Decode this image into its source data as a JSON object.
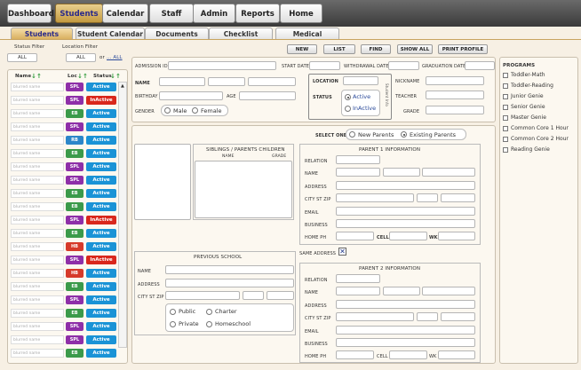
{
  "nav": {
    "tabs": [
      "Dashboard",
      "Students",
      "Calendar",
      "Staff",
      "Admin",
      "Reports",
      "Home"
    ],
    "active": "Students"
  },
  "subnav": {
    "tabs": [
      "Students",
      "Student Calendar",
      "Documents",
      "Checklist",
      "Medical"
    ]
  },
  "filters": {
    "status_label": "Status Filter",
    "location_label": "Location Filter",
    "status_value": "ALL",
    "location_value": "ALL",
    "or_text": "or",
    "all_link": "... ALL"
  },
  "list": {
    "headers": {
      "name": "Name",
      "loc": "Loc",
      "status": "Status"
    },
    "rows": [
      {
        "name": "blurred name",
        "loc": "SPL",
        "status": "Active"
      },
      {
        "name": "blurred name",
        "loc": "SPL",
        "status": "InActive"
      },
      {
        "name": "blurred name",
        "loc": "EB",
        "status": "Active"
      },
      {
        "name": "blurred name",
        "loc": "SPL",
        "status": "Active"
      },
      {
        "name": "blurred name",
        "loc": "RB",
        "status": "Active"
      },
      {
        "name": "blurred name",
        "loc": "EB",
        "status": "Active"
      },
      {
        "name": "blurred name",
        "loc": "SPL",
        "status": "Active"
      },
      {
        "name": "blurred name",
        "loc": "SPL",
        "status": "Active"
      },
      {
        "name": "blurred name",
        "loc": "EB",
        "status": "Active"
      },
      {
        "name": "blurred name",
        "loc": "EB",
        "status": "Active"
      },
      {
        "name": "blurred name",
        "loc": "SPL",
        "status": "InActive"
      },
      {
        "name": "blurred name",
        "loc": "EB",
        "status": "Active"
      },
      {
        "name": "blurred name",
        "loc": "HB",
        "status": "Active"
      },
      {
        "name": "blurred name",
        "loc": "SPL",
        "status": "InActive"
      },
      {
        "name": "blurred name",
        "loc": "HB",
        "status": "Active"
      },
      {
        "name": "blurred name",
        "loc": "EB",
        "status": "Active"
      },
      {
        "name": "blurred name",
        "loc": "SPL",
        "status": "Active"
      },
      {
        "name": "blurred name",
        "loc": "EB",
        "status": "Active"
      },
      {
        "name": "blurred name",
        "loc": "SPL",
        "status": "Active"
      },
      {
        "name": "blurred name",
        "loc": "SPL",
        "status": "Active"
      },
      {
        "name": "blurred name",
        "loc": "EB",
        "status": "Active"
      }
    ],
    "scroll_up": "▲",
    "scroll_down": "▼"
  },
  "actions": [
    "NEW",
    "LIST",
    "FIND",
    "SHOW ALL",
    "PRINT PROFILE"
  ],
  "student": {
    "admission_id": "ADMISSION ID",
    "start_date": "START DATE",
    "withdrawal_date": "WITHDRAWAL DATE",
    "graduation_date": "GRADUATION DATE",
    "name": "NAME",
    "birthday": "BIRTHDAY",
    "age": "AGE",
    "gender": "GENDER",
    "male": "Male",
    "female": "Female",
    "location": "LOCATION",
    "status": "STATUS",
    "active": "Active",
    "inactive": "InActive",
    "vertical_tag": "Student Info",
    "nickname": "NICKNAME",
    "teacher": "TEACHER",
    "grade": "GRADE"
  },
  "programs": {
    "title": "PROGRAMS",
    "items": [
      "Toddler-Math",
      "Toddler-Reading",
      "Junior Genie",
      "Senior Genie",
      "Master Genie",
      "Common Core 1 Hour",
      "Common Core 2 Hour",
      "Reading Genie"
    ]
  },
  "siblings": {
    "title": "SIBLINGS / PARENTS CHILDREN",
    "col_name": "NAME",
    "col_grade": "GRADE"
  },
  "select_one": {
    "label": "SELECT ONE",
    "new_parents": "New Parents",
    "existing_parents": "Existing Parents"
  },
  "parent1": {
    "title": "PARENT 1 INFORMATION",
    "relation": "RELATION",
    "name": "NAME",
    "address": "ADDRESS",
    "city": "CITY ST ZIP",
    "email": "EMAIL",
    "business": "BUSINESS",
    "home_ph": "HOME PH",
    "cell": "CELL",
    "wk": "WK"
  },
  "previous_school": {
    "title": "PREVIOUS SCHOOL",
    "name": "NAME",
    "address": "ADDRESS",
    "city": "CITY ST ZIP",
    "public": "Public",
    "charter": "Charter",
    "private": "Private",
    "homeschool": "Homeschool"
  },
  "same_address": {
    "label": "SAME ADDRESS",
    "mark": "✕"
  },
  "parent2": {
    "title": "PARENT 2 INFORMATION",
    "relation": "RELATION",
    "name": "NAME",
    "address": "ADDRESS",
    "city": "CITY ST ZIP",
    "email": "EMAIL",
    "business": "BUSINESS",
    "home_ph": "HOME PH",
    "cell": "CELL",
    "wk": "WK"
  },
  "colors": {
    "spl": "#8e2fa8",
    "eb": "#3b9a4a",
    "rb": "#2c86c9",
    "hb": "#d63a2a",
    "active": "#1a93d6",
    "inactive": "#d9271c",
    "nav_active": "#c39a40"
  }
}
